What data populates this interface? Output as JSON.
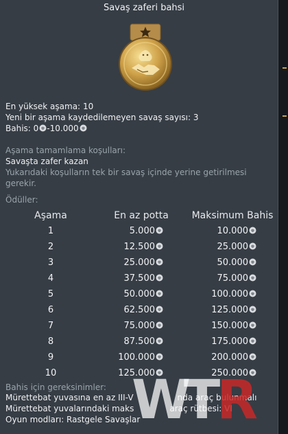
{
  "title": "Savaş zaferi bahsi",
  "info": {
    "highest_stage_label": "En yüksek aşama:",
    "highest_stage_value": "10",
    "unrecorded_label": "Yeni bir aşama kaydedilemeyen savaş sayısı:",
    "unrecorded_value": "3",
    "bet_label": "Bahis:",
    "bet_min": "0",
    "bet_max": "-10.000"
  },
  "conditions": {
    "header": "Aşama tamamlama koşulları:",
    "main": "Savaşta zafer kazan",
    "note_line1": "Yukarıdaki koşulların tek bir savaş içinde yerine getirilmesi",
    "note_line2": "gerekir."
  },
  "rewards": {
    "header": "Ödüller:",
    "columns": [
      "Aşama",
      "En az potta",
      "Maksimum Bahis"
    ],
    "rows": [
      {
        "stage": "1",
        "min_pot": "5.000",
        "max_bet": "10.000"
      },
      {
        "stage": "2",
        "min_pot": "12.500",
        "max_bet": "25.000"
      },
      {
        "stage": "3",
        "min_pot": "25.000",
        "max_bet": "50.000"
      },
      {
        "stage": "4",
        "min_pot": "37.500",
        "max_bet": "75.000"
      },
      {
        "stage": "5",
        "min_pot": "50.000",
        "max_bet": "100.000"
      },
      {
        "stage": "6",
        "min_pot": "62.500",
        "max_bet": "125.000"
      },
      {
        "stage": "7",
        "min_pot": "75.000",
        "max_bet": "150.000"
      },
      {
        "stage": "8",
        "min_pot": "87.500",
        "max_bet": "175.000"
      },
      {
        "stage": "9",
        "min_pot": "100.000",
        "max_bet": "200.000"
      },
      {
        "stage": "10",
        "min_pot": "125.000",
        "max_bet": "250.000"
      }
    ]
  },
  "requirements": {
    "header": "Bahis için gereksinimler:",
    "line1": "Mürettebat yuvasına en az III-V",
    "line1_tail": "nda araç bulunmalı",
    "line2": "Mürettebat yuvalarındaki maks",
    "line2_tail": "araç rütbesi: VI",
    "modes_label": "Oyun modları:",
    "modes_value": "Rastgele Savaşlar"
  },
  "watermark": {
    "w": "W",
    "t": "T",
    "r": "R"
  },
  "colors": {
    "panel": "#363d45",
    "medal_gold": "#c9a24a",
    "dim_text": "#9aa3ab"
  },
  "icons": {
    "medal": "gold-medal-lion-handshake-icon",
    "currency": "lion-coin-icon"
  }
}
